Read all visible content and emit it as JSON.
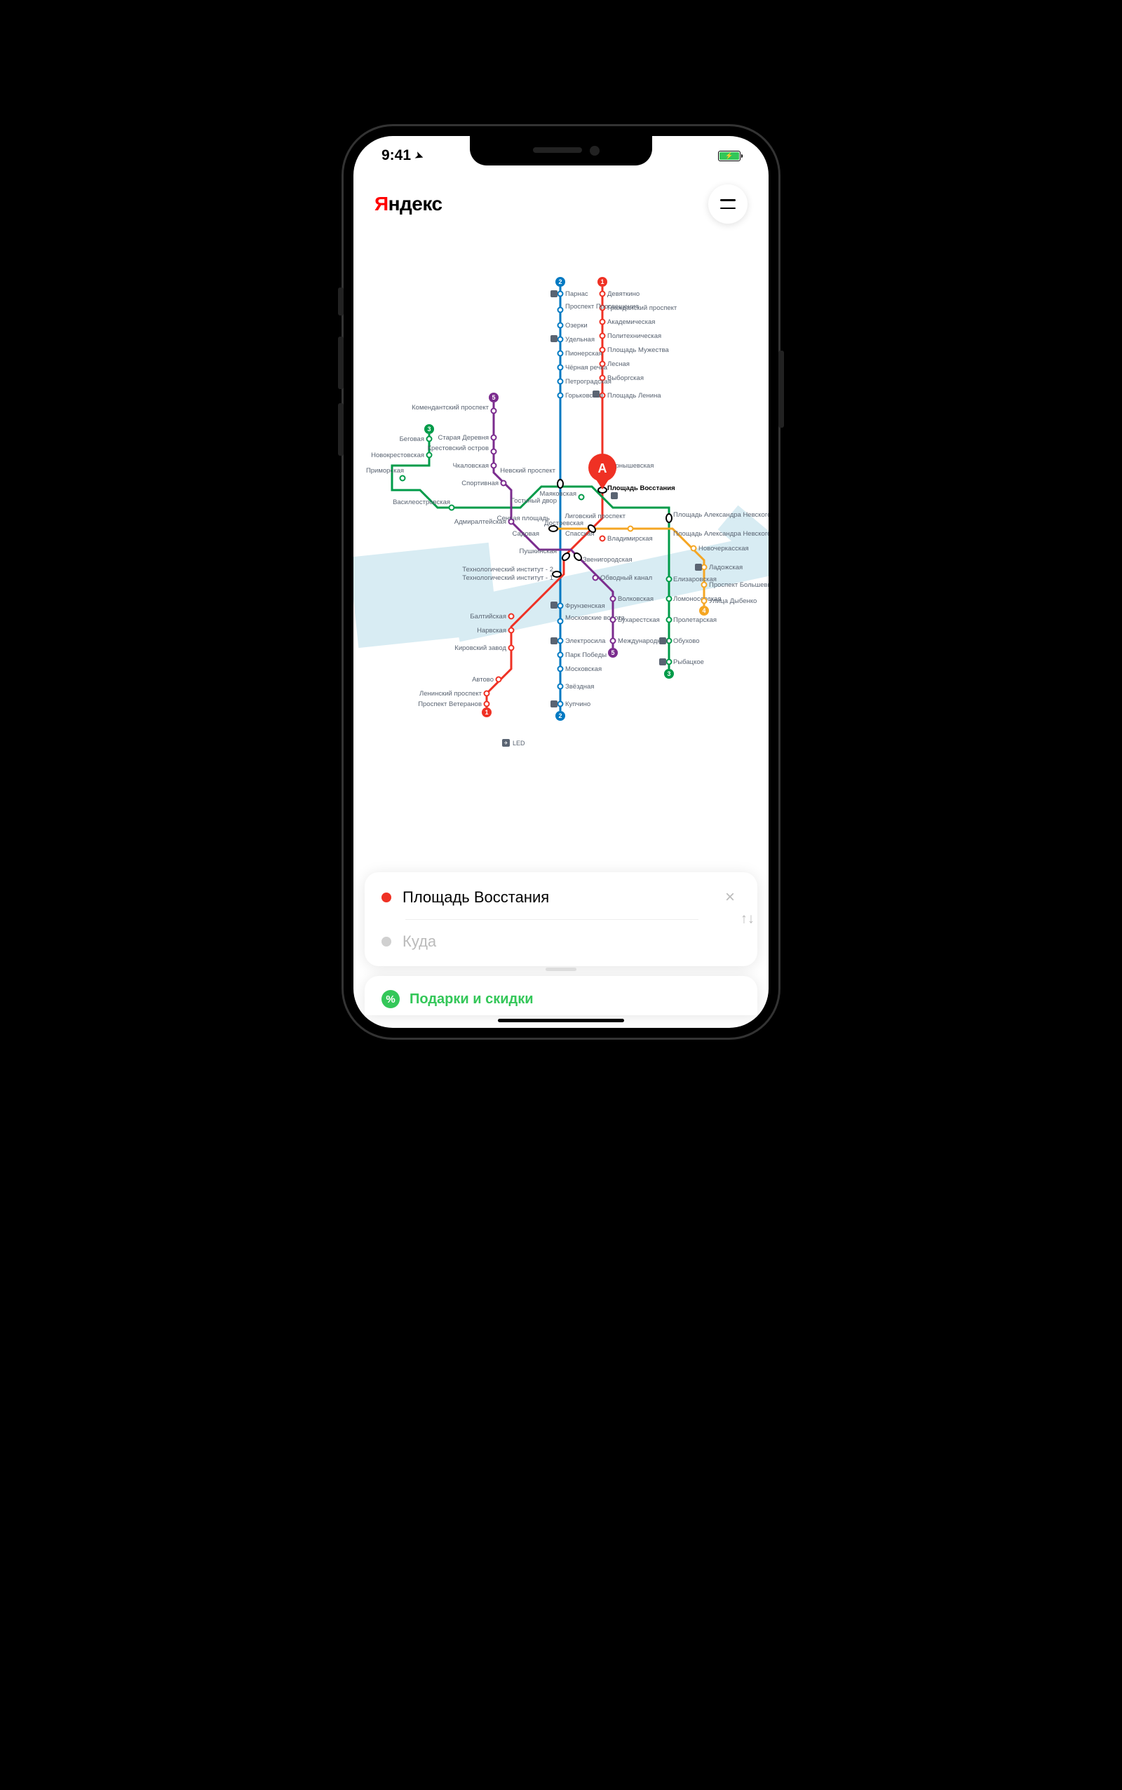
{
  "status": {
    "time": "9:41",
    "gps_icon": "➤"
  },
  "header": {
    "logo_y": "Я",
    "logo_rest": "ндекс"
  },
  "selected_pin": {
    "label": "А",
    "station": "Площадь Восстания"
  },
  "route": {
    "from": "Площадь Восстания",
    "to_placeholder": "Куда"
  },
  "promo": {
    "label": "Подарки и скидки"
  },
  "airport": {
    "code": "LED"
  },
  "line_colors": {
    "l1": "#ef3124",
    "l2": "#0079c2",
    "l3": "#009b49",
    "l4": "#f5a623",
    "l5": "#7b2c8e"
  },
  "lines": {
    "l1": [
      "Девяткино",
      "Гражданский проспект",
      "Академическая",
      "Политехническая",
      "Площадь Мужества",
      "Лесная",
      "Выборгская",
      "Площадь Ленина",
      "Чернышевская",
      "Площадь Восстания",
      "Владимирская",
      "Пушкинская",
      "Технологический институт - 1",
      "Балтийская",
      "Нарвская",
      "Кировский завод",
      "Автово",
      "Ленинский проспект",
      "Проспект Ветеранов"
    ],
    "l2": [
      "Парнас",
      "Проспект Просвещения",
      "Озерки",
      "Удельная",
      "Пионерская",
      "Чёрная речка",
      "Петроградская",
      "Горьковская",
      "Невский проспект",
      "Сенная площадь",
      "Технологический институт - 2",
      "Фрунзенская",
      "Московские ворота",
      "Электросила",
      "Парк Победы",
      "Московская",
      "Звёздная",
      "Купчино"
    ],
    "l3": [
      "Беговая",
      "Новокрестовская",
      "Приморская",
      "Василеостровская",
      "Гостиный двор",
      "Маяковская",
      "Площадь Александра Невского",
      "Елизаровская",
      "Ломоносовская",
      "Пролетарская",
      "Обухово",
      "Рыбацкое"
    ],
    "l4": [
      "Спасская",
      "Достоевская",
      "Лиговский проспект",
      "Площадь Александра Невского",
      "Новочеркасская",
      "Ладожская",
      "Проспект Большевиков",
      "Улица Дыбенко"
    ],
    "l5": [
      "Комендантский проспект",
      "Старая Деревня",
      "Крестовский остров",
      "Чкаловская",
      "Спортивная",
      "Адмиралтейская",
      "Садовая",
      "Звенигородская",
      "Обводный канал",
      "Волковская",
      "Бухарестская",
      "Международная"
    ]
  }
}
